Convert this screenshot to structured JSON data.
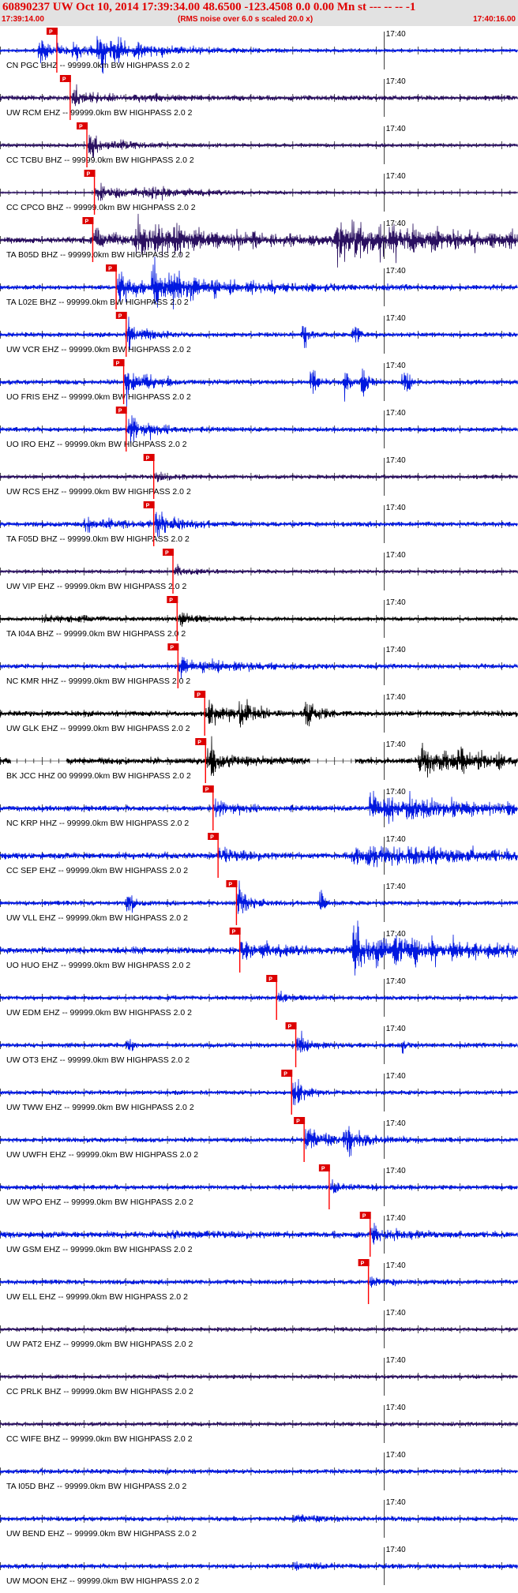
{
  "header": {
    "title": "60890237 UW Oct 10, 2014 17:39:34.00   48.6500 -123.4508  0.0 0.00 Mn st --- -- --  -1",
    "start_time": "17:39:14.00",
    "rms_note": "(RMS noise over 6.0 s scaled 20.0 x)",
    "end_time": "17:40:16.00"
  },
  "colors": {
    "header_bg": "#e2e2e2",
    "header_text": "#e00000",
    "pick_line": "#ff0000",
    "pick_box": "#dd0000",
    "tick": "#000000"
  },
  "chart_data": {
    "type": "line",
    "title": "",
    "x_range": [
      "17:39:14.00",
      "17:40:16.00"
    ],
    "minute_mark_label": "17:40",
    "minute_mark_time": "17:40:00",
    "pick_label": "P",
    "series": [
      {
        "name": "CN PGC BHZ -- 99999.0km BW  HIGHPASS  2.0  2",
        "color": "#0018e0",
        "pick_s": 6.8,
        "amp": 1.2,
        "bursts": [
          [
            4.4,
            2.5,
            9,
            2
          ],
          [
            11.4,
            3,
            12,
            6
          ],
          [
            8.4,
            4,
            5,
            2
          ]
        ]
      },
      {
        "name": "UW RCM EHZ -- 99999.0km BW  HIGHPASS  2.0  2",
        "color": "#2a1060",
        "pick_s": 8.4,
        "amp": 2.2,
        "bursts": [
          [
            8.4,
            2.5,
            8,
            2
          ],
          [
            16,
            6,
            2,
            3
          ]
        ]
      },
      {
        "name": "CC TCBU BHZ -- 99999.0km BW  HIGHPASS  2.0  2",
        "color": "#2a1060",
        "pick_s": 10.4,
        "amp": 1.4,
        "bursts": [
          [
            10.4,
            2,
            9,
            2
          ],
          [
            14,
            4,
            2,
            3
          ]
        ]
      },
      {
        "name": "CC CPCO BHZ -- 99999.0km BW  HIGHPASS  2.0  2",
        "color": "#2a1060",
        "pick_s": 11.3,
        "amp": 0.3,
        "bursts": [
          [
            11.3,
            4,
            7,
            5
          ],
          [
            17,
            10,
            4,
            6
          ]
        ]
      },
      {
        "name": "TA B05D BHZ -- 99999.0km BW  HIGHPASS  2.0  2",
        "color": "#2a1060",
        "pick_s": 11.1,
        "amp": 3,
        "bursts": [
          [
            11.1,
            3,
            6,
            4
          ],
          [
            16,
            14,
            14,
            8
          ],
          [
            40,
            20,
            16,
            10
          ]
        ]
      },
      {
        "name": "TA L02E BHZ -- 99999.0km BW  HIGHPASS  2.0  2",
        "color": "#0018e0",
        "pick_s": 13.9,
        "amp": 2,
        "bursts": [
          [
            13.9,
            2,
            14,
            2
          ],
          [
            18,
            10,
            16,
            6
          ]
        ]
      },
      {
        "name": "UW VCR EHZ -- 99999.0km BW  HIGHPASS  2.0  2",
        "color": "#0018e0",
        "pick_s": 15.1,
        "amp": 2,
        "bursts": [
          [
            15.1,
            1.5,
            10,
            2
          ],
          [
            36,
            1,
            12,
            0.4
          ],
          [
            42,
            1,
            12,
            0.4
          ]
        ]
      },
      {
        "name": "UO FRIS EHZ -- 99999.0km BW  HIGHPASS  2.0  2",
        "color": "#0018e0",
        "pick_s": 14.8,
        "amp": 2,
        "bursts": [
          [
            14.8,
            2,
            14,
            2
          ],
          [
            37,
            1,
            16,
            0.4
          ],
          [
            41,
            1,
            16,
            0.4
          ],
          [
            43,
            1,
            14,
            0.4
          ],
          [
            48,
            1,
            16,
            0.4
          ]
        ]
      },
      {
        "name": "UO IRO EHZ -- 99999.0km BW  HIGHPASS  2.0  2",
        "color": "#0018e0",
        "pick_s": 15.1,
        "amp": 2,
        "bursts": [
          [
            15.1,
            2,
            14,
            2
          ]
        ]
      },
      {
        "name": "UW RCS EHZ -- 99999.0km BW  HIGHPASS  2.0  2",
        "color": "#2a1060",
        "pick_s": 18.4,
        "amp": 1.6,
        "bursts": [
          [
            18.4,
            2,
            3,
            2
          ]
        ]
      },
      {
        "name": "TA F05D BHZ -- 99999.0km BW  HIGHPASS  2.0  2",
        "color": "#0018e0",
        "pick_s": 18.4,
        "amp": 2.2,
        "bursts": [
          [
            18.4,
            2,
            10,
            2
          ],
          [
            10,
            5,
            5,
            3
          ]
        ]
      },
      {
        "name": "UW VIP EHZ -- 99999.0km BW  HIGHPASS  2.0  2",
        "color": "#2a1060",
        "pick_s": 20.7,
        "amp": 1.3,
        "bursts": [
          [
            20.7,
            2,
            4,
            2
          ]
        ]
      },
      {
        "name": "TA I04A BHZ -- 99999.0km BW  HIGHPASS  2.0  2",
        "color": "#000000",
        "pick_s": 21.2,
        "amp": 1.6,
        "bursts": [
          [
            21.2,
            2,
            6,
            2
          ],
          [
            5,
            5,
            3,
            4
          ]
        ]
      },
      {
        "name": "NC KMR HHZ -- 99999.0km BW  HIGHPASS  2.0  2",
        "color": "#0018e0",
        "pick_s": 21.3,
        "amp": 2,
        "bursts": [
          [
            21.3,
            2,
            10,
            2
          ],
          [
            25,
            6,
            4,
            4
          ]
        ]
      },
      {
        "name": "UW GLK EHZ -- 99999.0km BW  HIGHPASS  2.0  2",
        "color": "#000000",
        "pick_s": 24.5,
        "amp": 2.5,
        "bursts": [
          [
            24.5,
            2,
            12,
            2
          ],
          [
            28.5,
            1.5,
            14,
            1
          ],
          [
            36.3,
            1.5,
            12,
            1
          ]
        ]
      },
      {
        "name": "BK JCC HHZ 00 99999.0km BW  HIGHPASS  2.0  2",
        "color": "#000000",
        "pick_s": 24.6,
        "amp": 3,
        "bursts": [
          [
            24.6,
            2,
            14,
            2
          ],
          [
            50,
            8,
            12,
            8
          ]
        ],
        "gaps": [
          [
            1.3,
            7.9
          ],
          [
            37,
            42.5
          ]
        ]
      },
      {
        "name": "NC KRP HHZ -- 99999.0km BW  HIGHPASS  2.0  2",
        "color": "#0018e0",
        "pick_s": 25.5,
        "amp": 2.5,
        "bursts": [
          [
            25.5,
            2,
            8,
            2
          ],
          [
            44,
            15,
            12,
            10
          ]
        ]
      },
      {
        "name": "CC SEP EHZ -- 99999.0km BW  HIGHPASS  2.0  2",
        "color": "#0018e0",
        "pick_s": 26.1,
        "amp": 3,
        "bursts": [
          [
            26.1,
            2,
            6,
            2
          ],
          [
            42,
            15,
            9,
            12
          ]
        ]
      },
      {
        "name": "UW VLL EHZ -- 99999.0km BW  HIGHPASS  2.0  2",
        "color": "#0018e0",
        "pick_s": 28.3,
        "amp": 2,
        "bursts": [
          [
            28.3,
            1.5,
            14,
            1
          ],
          [
            15,
            1,
            10,
            0.4
          ],
          [
            38,
            1,
            10,
            0.4
          ]
        ]
      },
      {
        "name": "UO HUO EHZ -- 99999.0km BW  HIGHPASS  2.0  2",
        "color": "#0018e0",
        "pick_s": 28.7,
        "amp": 3,
        "bursts": [
          [
            28.7,
            3,
            8,
            4
          ],
          [
            42,
            15,
            16,
            10
          ]
        ]
      },
      {
        "name": "UW EDM EHZ -- 99999.0km BW  HIGHPASS  2.0  2",
        "color": "#0018e0",
        "pick_s": 33.1,
        "amp": 1.8,
        "bursts": [
          [
            33.1,
            2,
            4,
            2
          ]
        ]
      },
      {
        "name": "UW OT3 EHZ -- 99999.0km BW  HIGHPASS  2.0  2",
        "color": "#0018e0",
        "pick_s": 35.4,
        "amp": 2,
        "bursts": [
          [
            35.4,
            1.5,
            14,
            1
          ],
          [
            15,
            1,
            8,
            0.3
          ],
          [
            47.6,
            1,
            6,
            0.3
          ]
        ]
      },
      {
        "name": "UW TWW EHZ -- 99999.0km BW  HIGHPASS  2.0  2",
        "color": "#0018e0",
        "pick_s": 34.9,
        "amp": 1.8,
        "bursts": [
          [
            34.9,
            1,
            18,
            1
          ]
        ]
      },
      {
        "name": "UW UWFH EHZ -- 99999.0km BW  HIGHPASS  2.0  2",
        "color": "#0018e0",
        "pick_s": 36.4,
        "amp": 2,
        "bursts": [
          [
            36.4,
            2,
            10,
            2
          ],
          [
            41,
            2,
            14,
            2
          ]
        ]
      },
      {
        "name": "UW WPO EHZ -- 99999.0km BW  HIGHPASS  2.0  2",
        "color": "#0018e0",
        "pick_s": 39.4,
        "amp": 2,
        "bursts": [
          [
            39.4,
            2,
            4,
            2
          ]
        ]
      },
      {
        "name": "UW GSM EHZ -- 99999.0km BW  HIGHPASS  2.0  2",
        "color": "#0018e0",
        "pick_s": 44.3,
        "amp": 3,
        "bursts": [
          [
            44.3,
            2,
            6,
            2
          ],
          [
            20,
            5,
            2,
            3
          ]
        ]
      },
      {
        "name": "UW ELL EHZ -- 99999.0km BW  HIGHPASS  2.0  2",
        "color": "#0018e0",
        "pick_s": 44.1,
        "amp": 2,
        "bursts": [
          [
            44.1,
            2,
            3,
            2
          ]
        ]
      },
      {
        "name": "UW PAT2 EHZ -- 99999.0km BW  HIGHPASS  2.0  2",
        "color": "#2a1060",
        "pick_s": null,
        "amp": 1.7,
        "bursts": []
      },
      {
        "name": "CC PRLK BHZ -- 99999.0km BW  HIGHPASS  2.0  2",
        "color": "#2a1060",
        "pick_s": null,
        "amp": 1.6,
        "bursts": []
      },
      {
        "name": "CC WIFE BHZ -- 99999.0km BW  HIGHPASS  2.0  2",
        "color": "#2a1060",
        "pick_s": null,
        "amp": 1.6,
        "bursts": []
      },
      {
        "name": "TA I05D BHZ -- 99999.0km BW  HIGHPASS  2.0  2",
        "color": "#0018e0",
        "pick_s": null,
        "amp": 2,
        "bursts": []
      },
      {
        "name": "UW BEND EHZ -- 99999.0km BW  HIGHPASS  2.0  2",
        "color": "#0018e0",
        "pick_s": null,
        "amp": 2,
        "bursts": [
          [
            35,
            6,
            2,
            4
          ]
        ]
      },
      {
        "name": "UW MOON EHZ -- 99999.0km BW  HIGHPASS  2.0  2",
        "color": "#0018e0",
        "pick_s": null,
        "amp": 2,
        "bursts": [
          [
            35,
            6,
            2,
            4
          ]
        ]
      }
    ]
  }
}
